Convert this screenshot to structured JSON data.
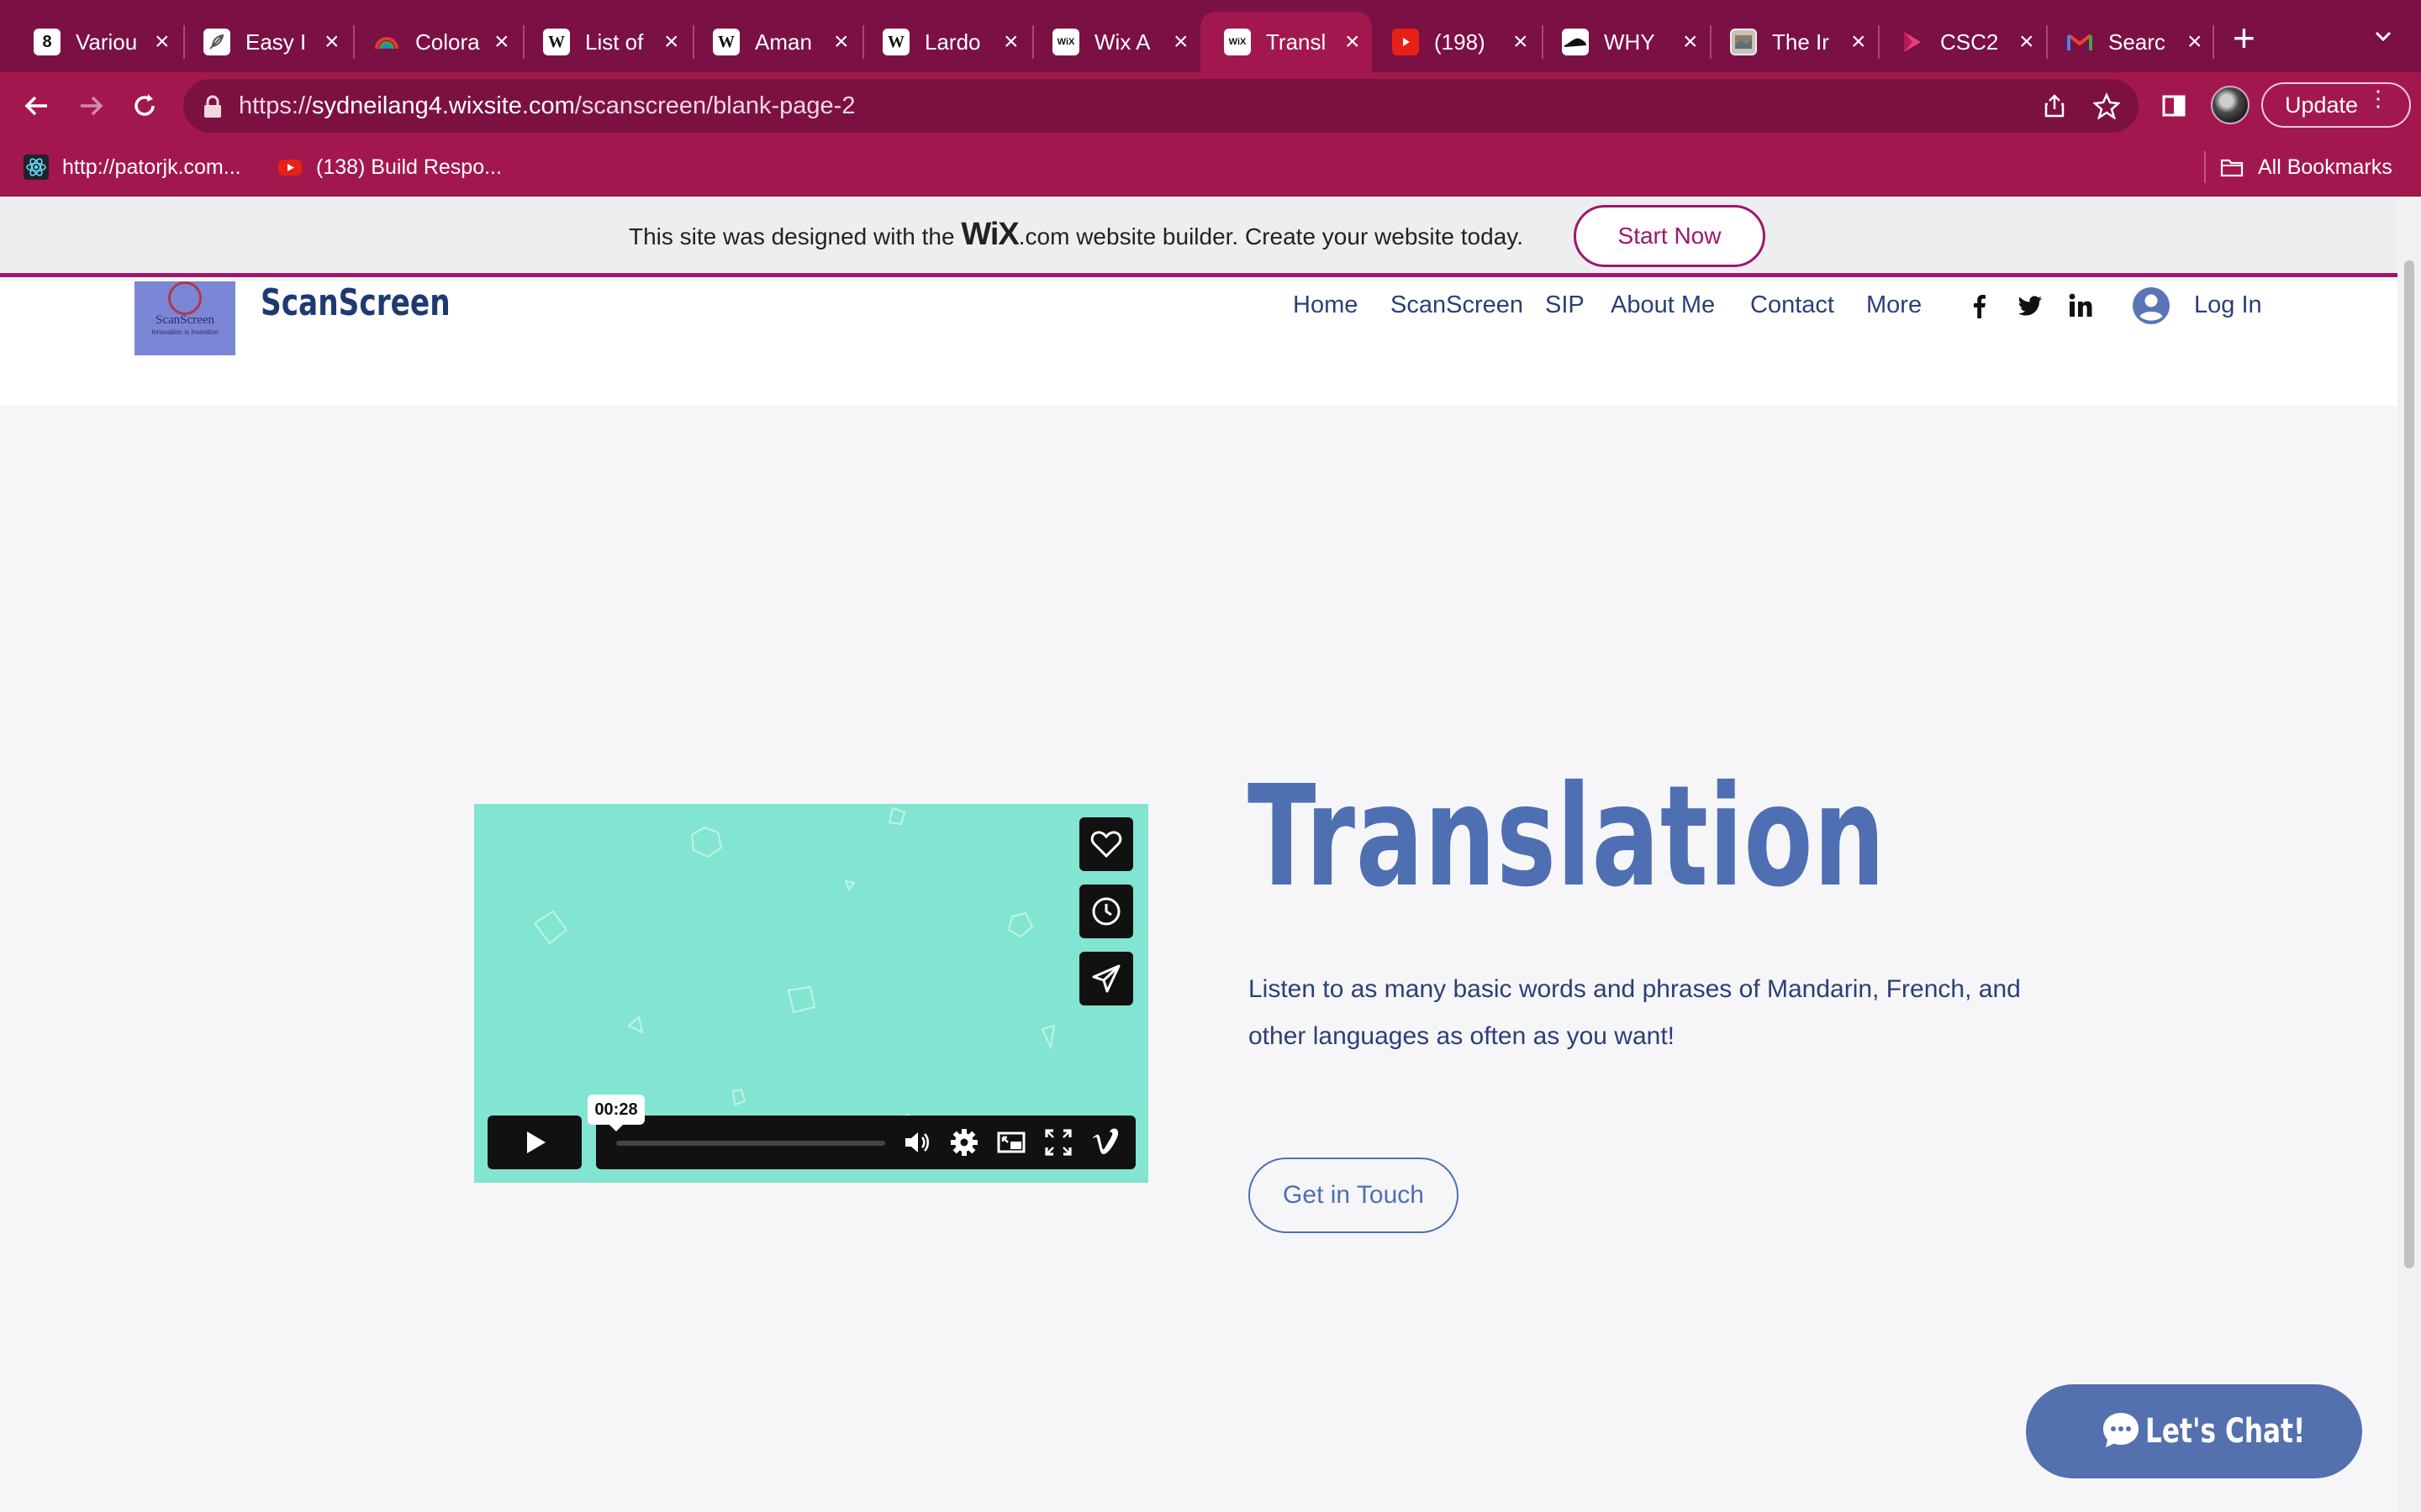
{
  "browser": {
    "tabs": [
      {
        "title": "Variou",
        "favicon": "b-icon",
        "active": false
      },
      {
        "title": "Easy I",
        "favicon": "feather-icon",
        "active": false
      },
      {
        "title": "Colora",
        "favicon": "rainbow-icon",
        "active": false
      },
      {
        "title": "List of",
        "favicon": "wikipedia-icon",
        "active": false
      },
      {
        "title": "Aman",
        "favicon": "wikipedia-icon",
        "active": false
      },
      {
        "title": "Lardo",
        "favicon": "wikipedia-icon",
        "active": false
      },
      {
        "title": "Wix A",
        "favicon": "wix-icon",
        "active": false
      },
      {
        "title": "Transl",
        "favicon": "wix-icon",
        "active": true
      },
      {
        "title": "(198)",
        "favicon": "youtube-icon",
        "active": false
      },
      {
        "title": "WHY",
        "favicon": "shoe-icon",
        "active": false
      },
      {
        "title": "The Ir",
        "favicon": "image-icon",
        "active": false
      },
      {
        "title": "CSC2",
        "favicon": "play-icon",
        "active": false
      },
      {
        "title": "Searc",
        "favicon": "gmail-icon",
        "active": false
      }
    ],
    "url_prefix": "https://",
    "url_host": "sydneilang4.wixsite.com",
    "url_path": "/scanscreen/blank-page-2",
    "update_label": "Update",
    "bookmarks": [
      {
        "label": "http://patorjk.com...",
        "icon": "react-icon"
      },
      {
        "label": "(138) Build Respo...",
        "icon": "youtube-icon"
      }
    ],
    "all_bookmarks_label": "All Bookmarks"
  },
  "wix_banner": {
    "text_before": "This site was designed with the ",
    "logo": "WiX",
    "text_after": ".com website builder. Create your website today.",
    "start_label": "Start Now"
  },
  "site": {
    "logo_text": "ScanScreen",
    "logo_subtext": "Innovation is Invention",
    "name": "ScanScreen",
    "nav": [
      "Home",
      "ScanScreen",
      "SIP",
      "About Me",
      "Contact",
      "More"
    ],
    "login_label": "Log In"
  },
  "video": {
    "time": "00:28"
  },
  "content": {
    "title": "Translation",
    "description": "Listen to as many basic words and phrases of Mandarin, French, and other languages as often as you want!",
    "cta_label": "Get in Touch"
  },
  "chat": {
    "label": "Let's Chat!"
  },
  "colors": {
    "tabbar": "#7a1044",
    "toolbar": "#a3174f",
    "wix_accent": "#a0156f",
    "brand_blue": "#4f6fb3",
    "video_bg": "#82e5d1"
  }
}
